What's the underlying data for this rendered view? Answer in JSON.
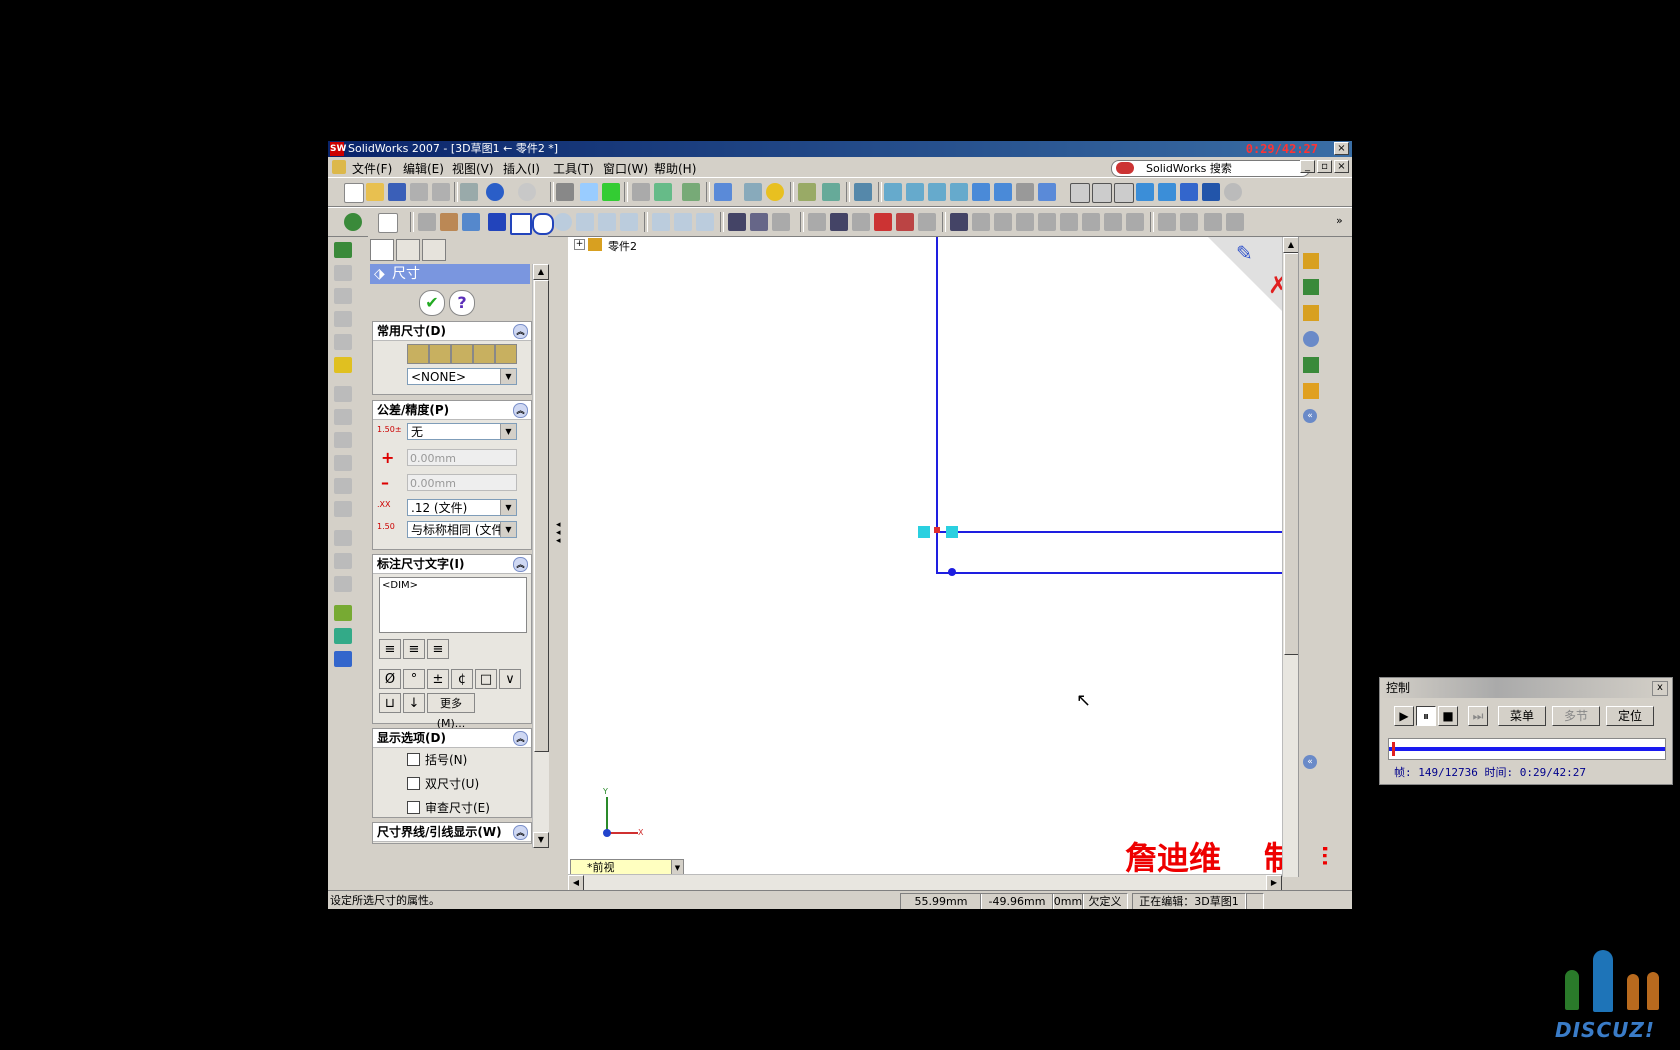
{
  "window": {
    "title": "SolidWorks 2007 - [3D草图1 ← 零件2 *]",
    "timer_overlay": "0:29/42:27",
    "logo": "SW"
  },
  "menubar": {
    "items": [
      "文件(F)",
      "编辑(E)",
      "视图(V)",
      "插入(I)",
      "工具(T)",
      "窗口(W)",
      "帮助(H)"
    ],
    "search_placeholder": "SolidWorks 搜索"
  },
  "tree": {
    "root_label": "零件2",
    "expand": "+"
  },
  "property_manager": {
    "title": "尺寸",
    "groups": {
      "favorites": {
        "title": "常用尺寸(D)",
        "combo_value": "<NONE>"
      },
      "tolerance": {
        "title": "公差/精度(P)",
        "tolerance_type": "无",
        "upper": "0.00mm",
        "lower": "0.00mm",
        "precision": ".12 (文件)",
        "tol_precision": "与标称相同 (文件)"
      },
      "dim_text": {
        "title": "标注尺寸文字(I)",
        "text": "<DIM>",
        "symbols": [
          "Ø",
          "°",
          "±",
          "¢",
          "□",
          "∨",
          "⊔",
          "↓"
        ],
        "more_label": "更多(M)..."
      },
      "display": {
        "title": "显示选项(D)",
        "options": [
          "括号(N)",
          "双尺寸(U)",
          "审查尺寸(E)"
        ]
      },
      "leaders": {
        "title": "尺寸界线/引线显示(W)"
      }
    }
  },
  "canvas": {
    "view_name": "*前视",
    "axis_x": "X",
    "axis_y": "Y"
  },
  "statusbar": {
    "message": "设定所选尺寸的属性。",
    "x": "55.99mm",
    "y": "-49.96mm",
    "z": "0mm",
    "state": "欠定义",
    "editing": "正在编辑：3D草图1"
  },
  "control_panel": {
    "title": "控制",
    "close": "x",
    "menu_label": "菜单",
    "multi_label": "多节",
    "locate_label": "定位",
    "info": "帧: 149/12736 时间: 0:29/42:27",
    "progress": 0.0117
  },
  "watermark": {
    "author": "詹迪维",
    "made": "制作",
    "logo_text": "DISCUZ!"
  },
  "colors": {
    "sketch_line": "#1e1ee0",
    "title_bar": "#0a246a",
    "watermark": "#e00000"
  }
}
